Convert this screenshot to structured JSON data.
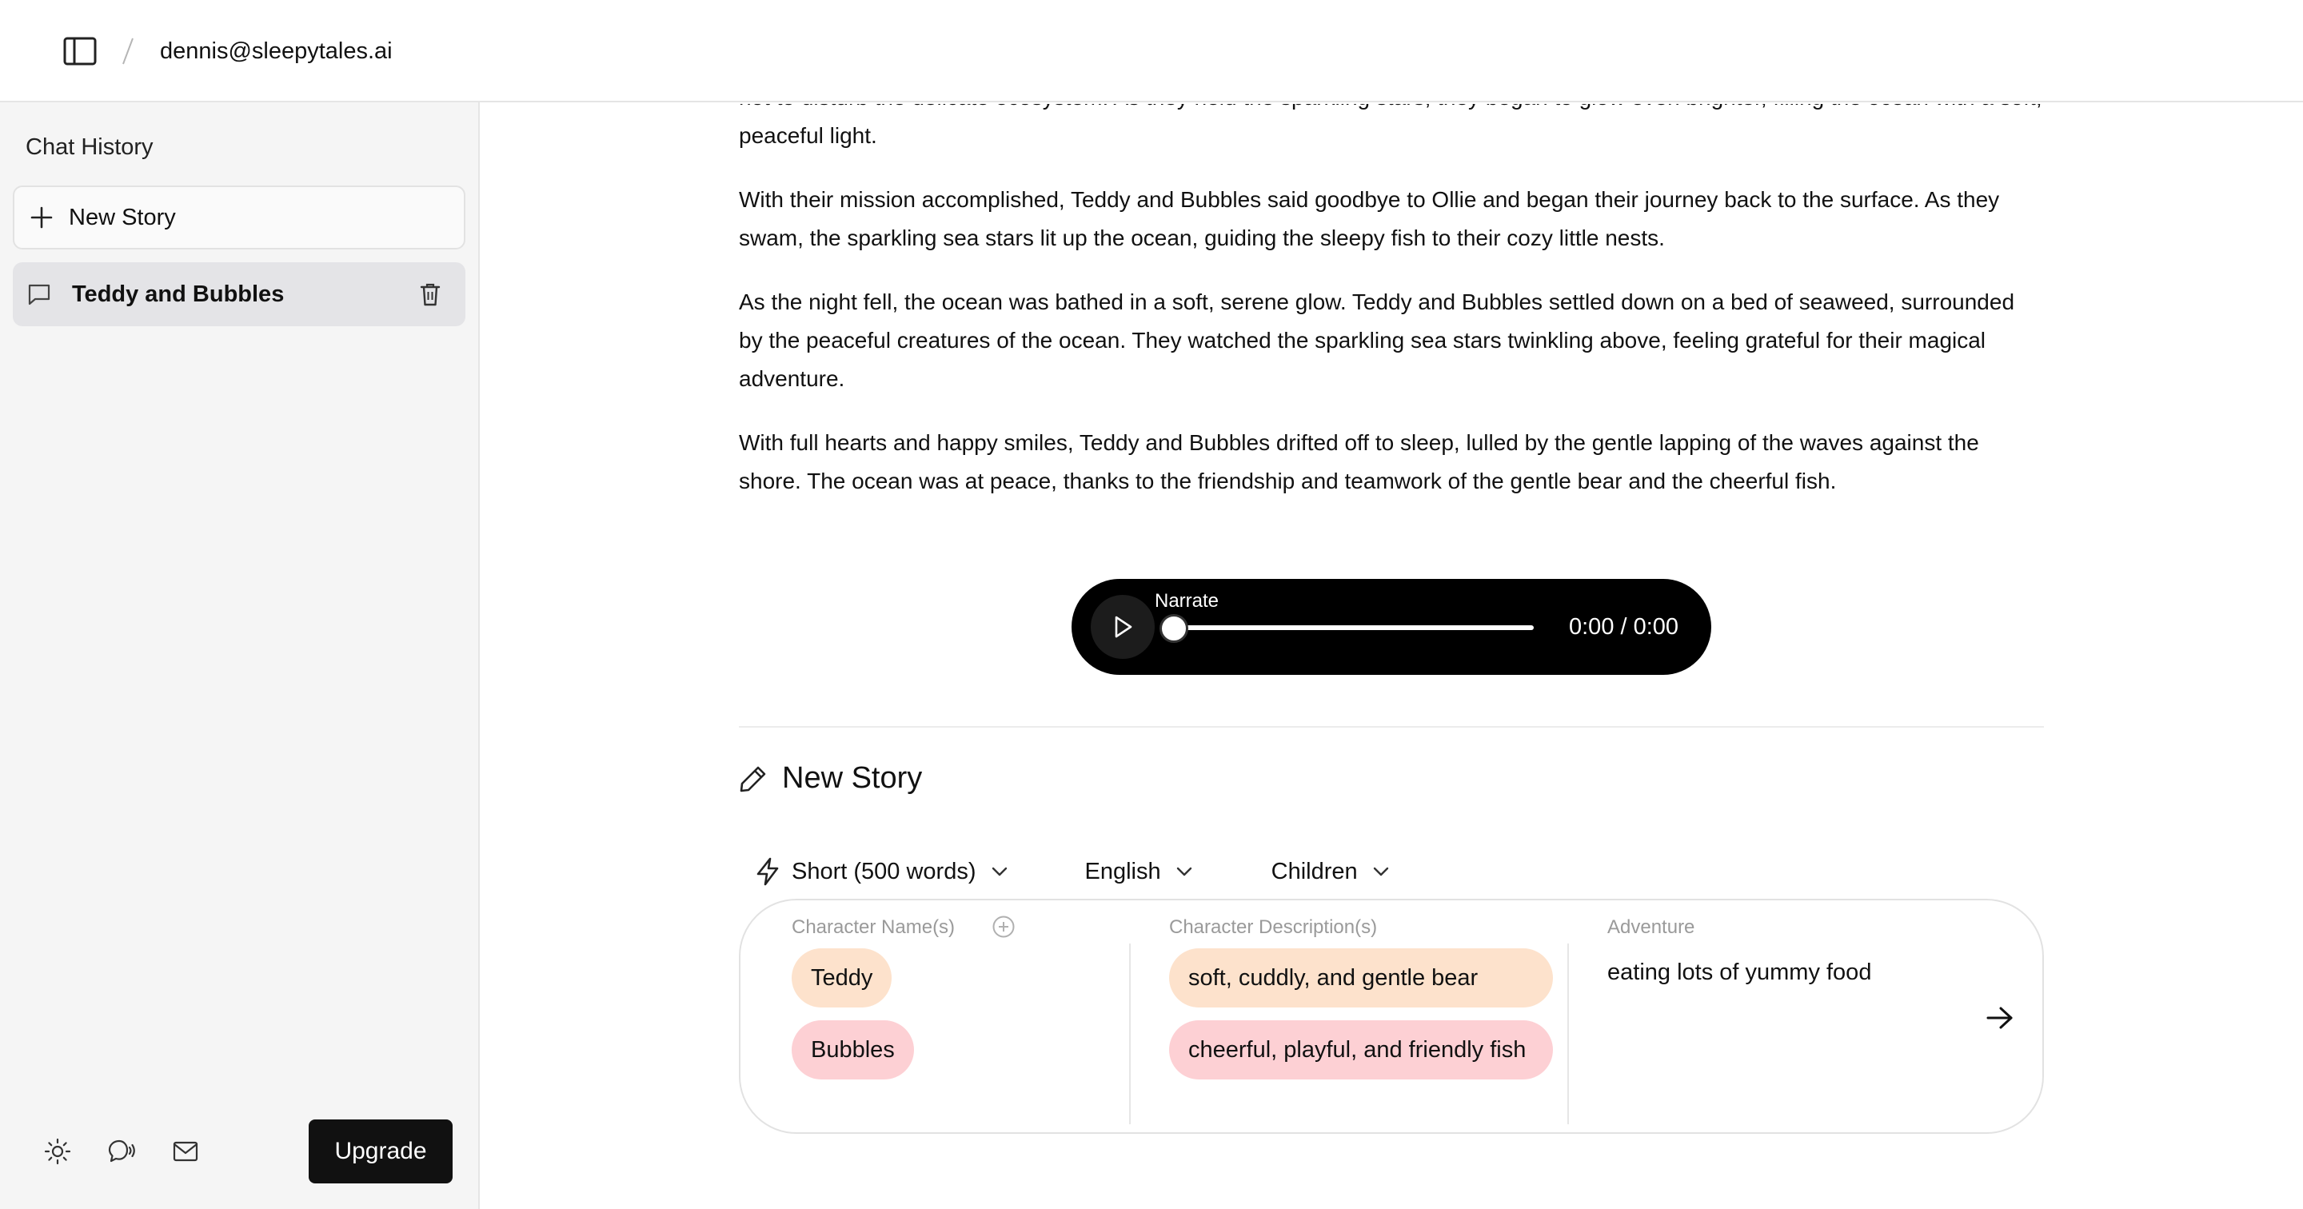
{
  "header": {
    "user_email": "dennis@sleepytales.ai"
  },
  "sidebar": {
    "heading": "Chat History",
    "new_story_label": "New Story",
    "history": [
      {
        "title": "Teddy and Bubbles"
      }
    ],
    "footer_icons": [
      "sun-icon",
      "speech-icon",
      "mail-icon"
    ],
    "upgrade_label": "Upgrade"
  },
  "story": {
    "paragraphs": [
      "not to disturb the delicate ecosystem. As they held the sparkling stars, they began to glow even brighter, filling the ocean with a soft, peaceful light.",
      "With their mission accomplished, Teddy and Bubbles said goodbye to Ollie and began their journey back to the surface. As they swam, the sparkling sea stars lit up the ocean, guiding the sleepy fish to their cozy little nests.",
      "As the night fell, the ocean was bathed in a soft, serene glow. Teddy and Bubbles settled down on a bed of seaweed, surrounded by the peaceful creatures of the ocean. They watched the sparkling sea stars twinkling above, feeling grateful for their magical adventure.",
      "With full hearts and happy smiles, Teddy and Bubbles drifted off to sleep, lulled by the gentle lapping of the waves against the shore. The ocean was at peace, thanks to the friendship and teamwork of the gentle bear and the cheerful fish."
    ]
  },
  "player": {
    "label": "Narrate",
    "time": "0:00 / 0:00",
    "progress": 0
  },
  "new_story": {
    "title": "New Story",
    "length_label": "Short (500 words)",
    "language_label": "English",
    "audience_label": "Children",
    "form": {
      "names_label": "Character Name(s)",
      "descriptions_label": "Character Description(s)",
      "adventure_label": "Adventure",
      "names": [
        "Teddy",
        "Bubbles"
      ],
      "descriptions": [
        "soft, cuddly, and gentle bear",
        "cheerful, playful, and friendly fish"
      ],
      "adventure": "eating lots of yummy food"
    }
  },
  "colors": {
    "chip_first": "#fde2cc",
    "chip_second": "#fdd0d4",
    "player_bg": "#000000",
    "upgrade_bg": "#111111"
  }
}
